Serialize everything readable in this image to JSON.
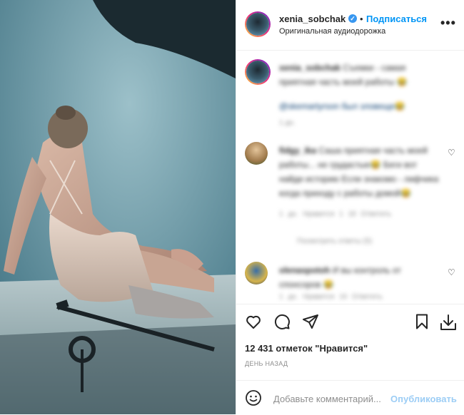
{
  "post": {
    "username": "xenia_sobchak",
    "verified_mark": "✓",
    "follow_label": "Подписаться",
    "audio_label": "Оригинальная аудиодорожка",
    "more_label": "•••",
    "image_alt": "woman-in-slip-dress-photoshoot"
  },
  "caption": {
    "username": "xenia_sobchak",
    "text": "Съемки - самая приятная часть моей работы 😂",
    "mention": "@skemartyrson был зловеще😂",
    "time": "1 дн."
  },
  "comments": [
    {
      "username": "fidgy_ika",
      "text": "Саша приятная часть моей работы... не грудастые😂 Беги вот найди историю Если знакомо - лифчика когда приходу с работы домой😂",
      "meta": "1 дн.   Нравится 1 18   Ответить",
      "replies": "Посмотреть ответы (5)",
      "heart": "♡"
    },
    {
      "username": "olenaspotoh",
      "text": "И вы контроль от спонсоров 😂",
      "meta": "1 дн.   Нравится 16   Ответить",
      "heart": "♡"
    }
  ],
  "actions": {
    "like_icon": "heart-icon",
    "comment_icon": "comment-icon",
    "share_icon": "send-icon",
    "save_icon": "bookmark-icon",
    "download_icon": "download-icon"
  },
  "likes_text": "12 431 отметок \"Нравится\"",
  "time_ago": "ДЕНЬ НАЗАД",
  "comment_box": {
    "placeholder": "Добавьте комментарий...",
    "publish_label": "Опубликовать",
    "emoji_icon": "smiley-icon"
  }
}
